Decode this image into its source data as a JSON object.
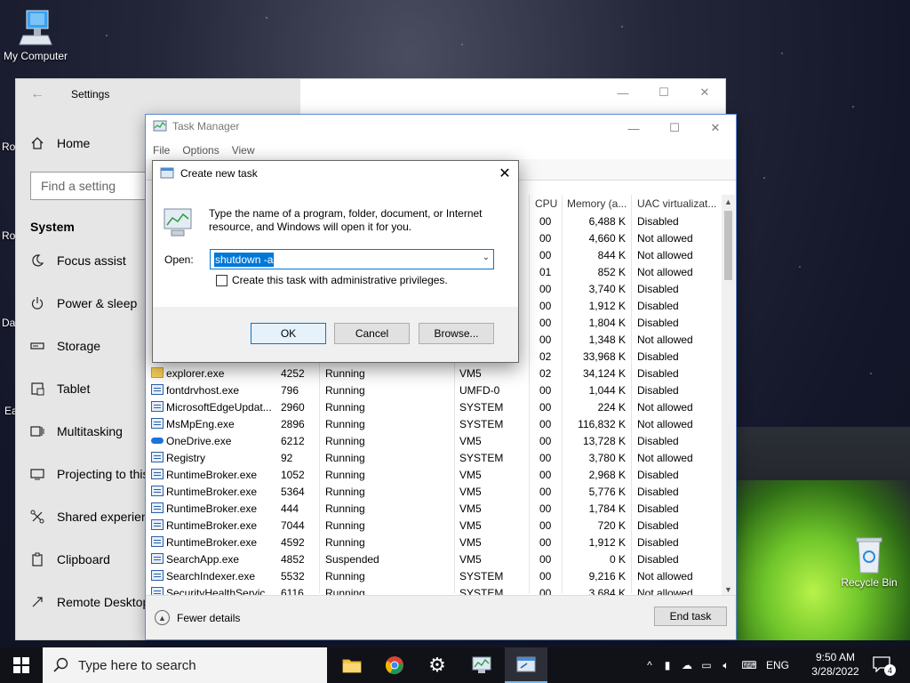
{
  "desktop": {
    "icons": {
      "my_computer": "My Computer",
      "recycle_bin": "Recycle Bin"
    },
    "edge_labels": [
      "Ro",
      "Ro",
      "Da",
      "Ea"
    ]
  },
  "settings": {
    "title": "Settings",
    "home": "Home",
    "search_placeholder": "Find a setting",
    "section": "System",
    "items": [
      {
        "label": "Focus assist",
        "icon": "moon-icon"
      },
      {
        "label": "Power & sleep",
        "icon": "power-icon"
      },
      {
        "label": "Storage",
        "icon": "storage-icon"
      },
      {
        "label": "Tablet",
        "icon": "tablet-icon"
      },
      {
        "label": "Multitasking",
        "icon": "multitasking-icon"
      },
      {
        "label": "Projecting to this PC",
        "icon": "projector-icon"
      },
      {
        "label": "Shared experiences",
        "icon": "shared-icon"
      },
      {
        "label": "Clipboard",
        "icon": "clipboard-icon"
      },
      {
        "label": "Remote Desktop",
        "icon": "remote-icon"
      }
    ]
  },
  "task_manager": {
    "title": "Task Manager",
    "menu": [
      "File",
      "Options",
      "View"
    ],
    "columns": {
      "cpu": "CPU",
      "memory": "Memory (a...",
      "uac": "UAC virtualizat..."
    },
    "top_rows": [
      {
        "cpu": "00",
        "mem": "6,488 K",
        "uac": "Disabled"
      },
      {
        "cpu": "00",
        "mem": "4,660 K",
        "uac": "Not allowed"
      },
      {
        "cpu": "00",
        "mem": "844 K",
        "uac": "Not allowed"
      },
      {
        "cpu": "01",
        "mem": "852 K",
        "uac": "Not allowed"
      },
      {
        "cpu": "00",
        "mem": "3,740 K",
        "uac": "Disabled"
      },
      {
        "cpu": "00",
        "mem": "1,912 K",
        "uac": "Disabled"
      },
      {
        "cpu": "00",
        "mem": "1,804 K",
        "uac": "Disabled"
      },
      {
        "cpu": "00",
        "mem": "1,348 K",
        "uac": "Not allowed"
      },
      {
        "cpu": "02",
        "mem": "33,968 K",
        "uac": "Disabled"
      }
    ],
    "rows": [
      {
        "name": "explorer.exe",
        "pid": "4252",
        "status": "Running",
        "user": "VM5",
        "cpu": "02",
        "mem": "34,124 K",
        "uac": "Disabled",
        "icon": "folder"
      },
      {
        "name": "fontdrvhost.exe",
        "pid": "796",
        "status": "Running",
        "user": "UMFD-0",
        "cpu": "00",
        "mem": "1,044 K",
        "uac": "Disabled",
        "icon": "app"
      },
      {
        "name": "MicrosoftEdgeUpdat...",
        "pid": "2960",
        "status": "Running",
        "user": "SYSTEM",
        "cpu": "00",
        "mem": "224 K",
        "uac": "Not allowed",
        "icon": "app"
      },
      {
        "name": "MsMpEng.exe",
        "pid": "2896",
        "status": "Running",
        "user": "SYSTEM",
        "cpu": "00",
        "mem": "116,832 K",
        "uac": "Not allowed",
        "icon": "app"
      },
      {
        "name": "OneDrive.exe",
        "pid": "6212",
        "status": "Running",
        "user": "VM5",
        "cpu": "00",
        "mem": "13,728 K",
        "uac": "Disabled",
        "icon": "cloud"
      },
      {
        "name": "Registry",
        "pid": "92",
        "status": "Running",
        "user": "SYSTEM",
        "cpu": "00",
        "mem": "3,780 K",
        "uac": "Not allowed",
        "icon": "app"
      },
      {
        "name": "RuntimeBroker.exe",
        "pid": "1052",
        "status": "Running",
        "user": "VM5",
        "cpu": "00",
        "mem": "2,968 K",
        "uac": "Disabled",
        "icon": "app"
      },
      {
        "name": "RuntimeBroker.exe",
        "pid": "5364",
        "status": "Running",
        "user": "VM5",
        "cpu": "00",
        "mem": "5,776 K",
        "uac": "Disabled",
        "icon": "app"
      },
      {
        "name": "RuntimeBroker.exe",
        "pid": "444",
        "status": "Running",
        "user": "VM5",
        "cpu": "00",
        "mem": "1,784 K",
        "uac": "Disabled",
        "icon": "app"
      },
      {
        "name": "RuntimeBroker.exe",
        "pid": "7044",
        "status": "Running",
        "user": "VM5",
        "cpu": "00",
        "mem": "720 K",
        "uac": "Disabled",
        "icon": "app"
      },
      {
        "name": "RuntimeBroker.exe",
        "pid": "4592",
        "status": "Running",
        "user": "VM5",
        "cpu": "00",
        "mem": "1,912 K",
        "uac": "Disabled",
        "icon": "app"
      },
      {
        "name": "SearchApp.exe",
        "pid": "4852",
        "status": "Suspended",
        "user": "VM5",
        "cpu": "00",
        "mem": "0 K",
        "uac": "Disabled",
        "icon": "app"
      },
      {
        "name": "SearchIndexer.exe",
        "pid": "5532",
        "status": "Running",
        "user": "SYSTEM",
        "cpu": "00",
        "mem": "9,216 K",
        "uac": "Not allowed",
        "icon": "app"
      },
      {
        "name": "SecurityHealthServic...",
        "pid": "6116",
        "status": "Running",
        "user": "SYSTEM",
        "cpu": "00",
        "mem": "3,684 K",
        "uac": "Not allowed",
        "icon": "app"
      }
    ],
    "fewer_details": "Fewer details",
    "end_task": "End task"
  },
  "dialog": {
    "title": "Create new task",
    "description": "Type the name of a program, folder, document, or Internet resource, and Windows will open it for you.",
    "open_label": "Open:",
    "open_value": "shutdown -a",
    "checkbox_label": "Create this task with administrative privileges.",
    "ok": "OK",
    "cancel": "Cancel",
    "browse": "Browse..."
  },
  "taskbar": {
    "search_placeholder": "Type here to search",
    "language": "ENG",
    "time": "9:50 AM",
    "date": "3/28/2022",
    "notification_count": "4"
  }
}
